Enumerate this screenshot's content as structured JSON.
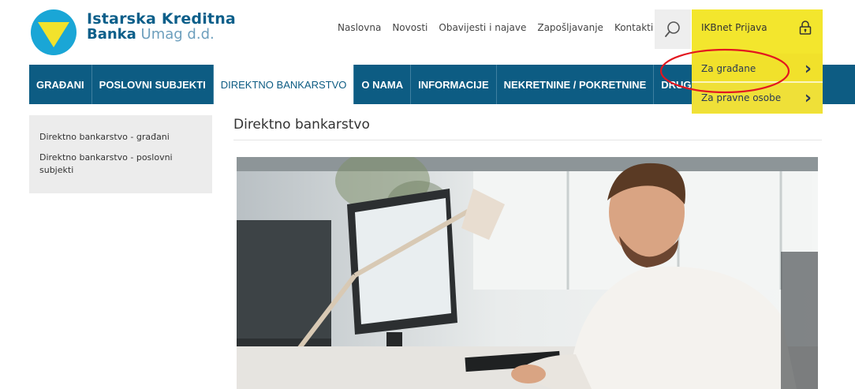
{
  "brand": {
    "line1": "Istarska Kreditna",
    "line2_bold": "Banka",
    "line2_sub": "Umag d.d.",
    "colors": {
      "primary": "#0d5c83",
      "accent": "#f3e62d",
      "logo_yellow": "#f2e22c",
      "logo_blue": "#1aa6d6"
    }
  },
  "topnav": {
    "items": [
      "Naslovna",
      "Novosti",
      "Obavijesti i najave",
      "Zapošljavanje",
      "Kontakti"
    ],
    "search_icon": "search-icon"
  },
  "ikbnet": {
    "title": "IKBnet Prijava",
    "lock_icon": "lock-icon",
    "items": [
      {
        "label": "Za građane",
        "icon": "chevron-right-icon"
      },
      {
        "label": "Za pravne osobe",
        "icon": "chevron-right-icon"
      }
    ]
  },
  "mainnav": {
    "items": [
      "GRAĐANI",
      "POSLOVNI SUBJEKTI",
      "DIREKTNO BANKARSTVO",
      "O NAMA",
      "INFORMACIJE",
      "NEKRETNINE / POKRETNINE",
      "DRUGI PROIZVODI"
    ],
    "active": "DIREKTNO BANKARSTVO"
  },
  "sidebar": {
    "items": [
      "Direktno bankarstvo - građani",
      "Direktno bankarstvo - poslovni subjekti"
    ]
  },
  "content": {
    "title": "Direktno bankarstvo"
  },
  "annotation": {
    "color": "#e3161f"
  }
}
